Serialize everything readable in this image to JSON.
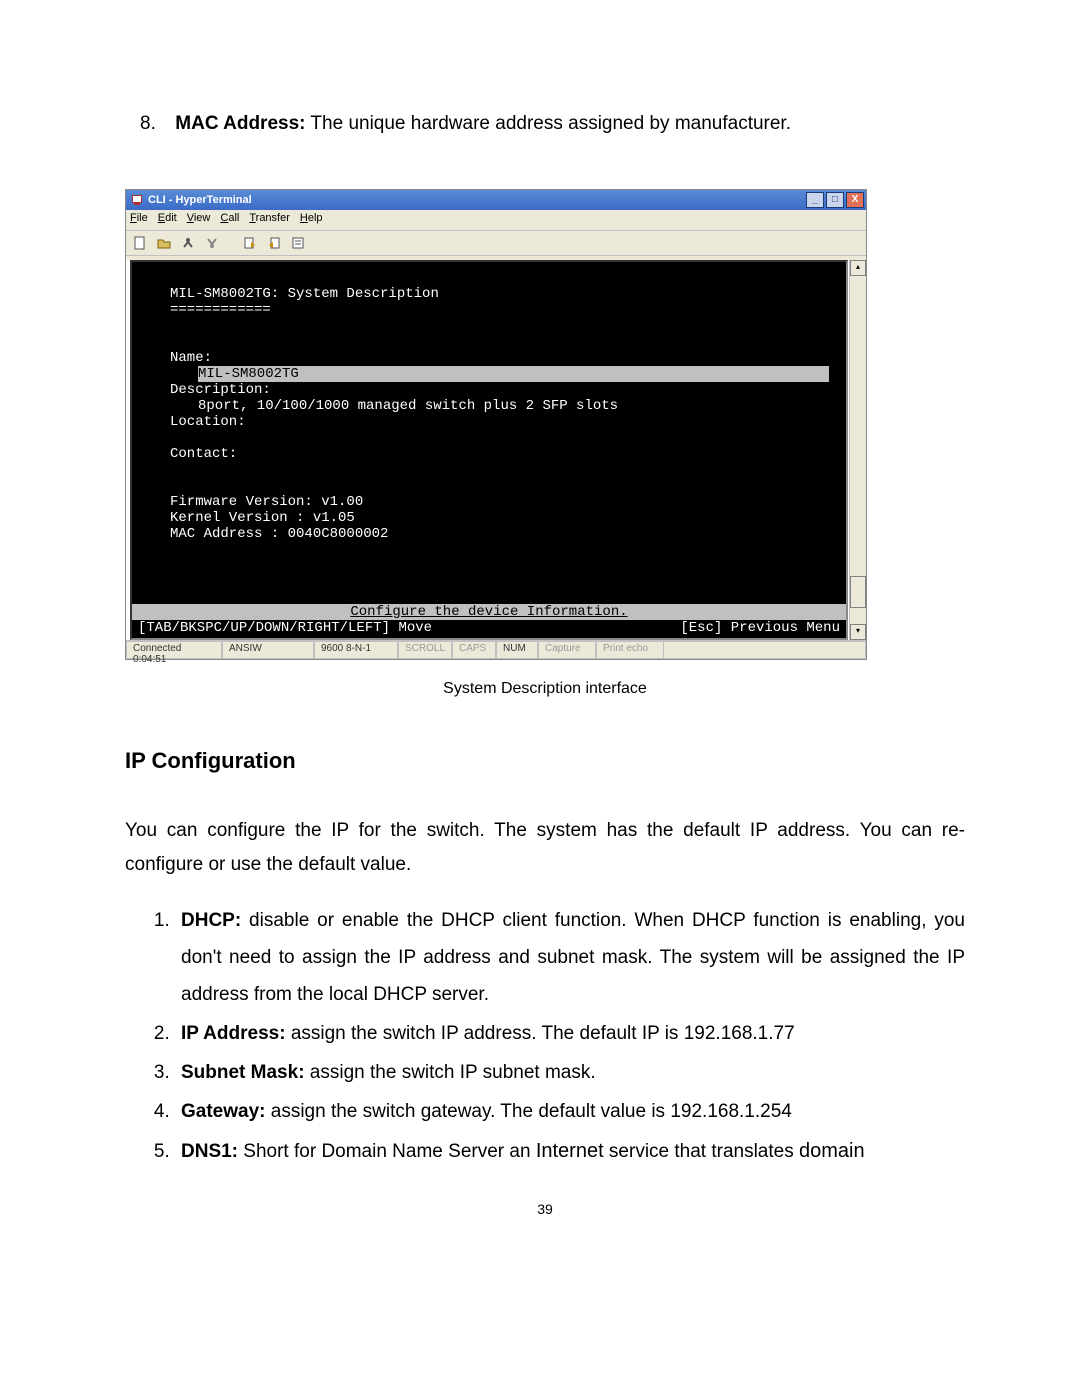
{
  "top_item": {
    "num": "8.",
    "label": "MAC Address:",
    "text": " The unique hardware address assigned by manufacturer."
  },
  "hyperterminal": {
    "title": "CLI - HyperTerminal",
    "menus": {
      "file": {
        "u": "F",
        "rest": "ile"
      },
      "edit": {
        "u": "E",
        "rest": "dit"
      },
      "view": {
        "u": "V",
        "rest": "iew"
      },
      "call": {
        "u": "C",
        "rest": "all"
      },
      "transfer": {
        "u": "T",
        "rest": "ransfer"
      },
      "help": {
        "u": "H",
        "rest": "elp"
      }
    },
    "terminal": {
      "header": "MIL-SM8002TG: System Description",
      "divider": "============",
      "name_label": "Name:",
      "name_value": "MIL-SM8002TG",
      "desc_label": "Description:",
      "desc_value": "8port, 10/100/1000 managed switch plus 2 SFP slots",
      "location": "Location:",
      "contact": "Contact:",
      "fw": "Firmware Version: v1.00",
      "kernel": "Kernel Version  : v1.05",
      "mac": "MAC Address     : 0040C8000002",
      "hint_center": "Configure the device Information.",
      "hint_left": "[TAB/BKSPC/UP/DOWN/RIGHT/LEFT] Move",
      "hint_right": "[Esc] Previous Menu"
    },
    "status": {
      "conn": "Connected 0:04:51",
      "term": "ANSIW",
      "speed": "9600 8-N-1",
      "scroll": "SCROLL",
      "caps": "CAPS",
      "num": "NUM",
      "capture": "Capture",
      "echo": "Print echo"
    }
  },
  "figure_caption": "System Description interface",
  "section_heading": "IP Configuration",
  "intro_para": "You can configure the IP for the switch. The system has the default IP address. You can re-configure or use the default value.",
  "items": {
    "i1_label": "DHCP:",
    "i1_text": " disable or enable the DHCP client function. When DHCP function is enabling, you don't need to assign the IP address and subnet mask. The system will be assigned the IP address from the local DHCP server.",
    "i2_label": "IP Address:",
    "i2_text": " assign the switch IP address. The default IP is 192.168.1.77",
    "i3_label": "Subnet Mask:",
    "i3_text": " assign the switch IP subnet mask.",
    "i4_label": "Gateway:",
    "i4_text": " assign the switch gateway. The default value is 192.168.1.254",
    "i5_label": "DNS1:",
    "i5_text_a": " Short for Domain Name Server an ",
    "i5_internet": "Internet",
    "i5_text_b": " service that translates ",
    "i5_domain": "domain"
  },
  "page_number": "39"
}
